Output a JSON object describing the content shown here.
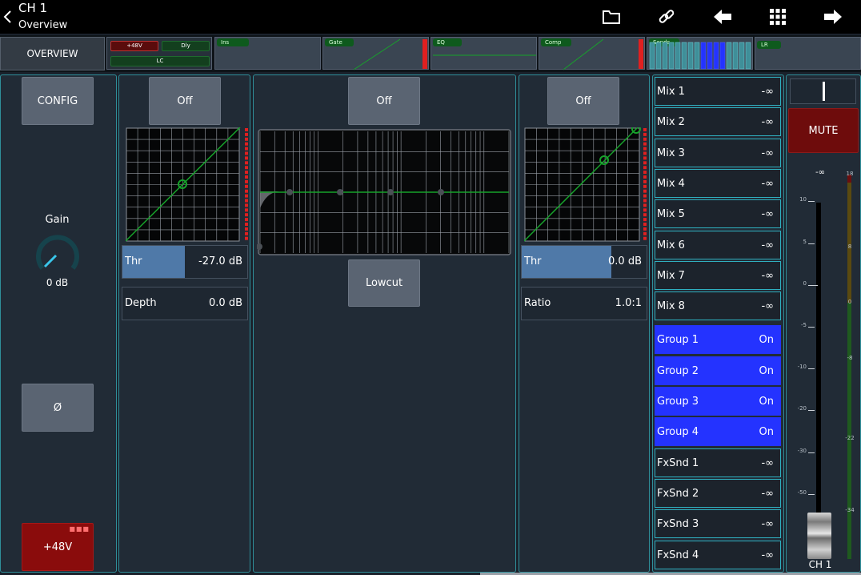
{
  "header": {
    "title": "CH 1",
    "subtitle": "Overview"
  },
  "strip": {
    "overview_tab": "OVERVIEW",
    "tag_48v": "+48V",
    "tag_dly": "Dly",
    "tag_lc": "LC",
    "ins": "Ins",
    "gate": "Gate",
    "eq": "EQ",
    "comp": "Comp",
    "sends": "Sends",
    "lr": "LR"
  },
  "config_panel": {
    "config_label": "CONFIG",
    "gain_label": "Gain",
    "gain_value": "0 dB",
    "phase_label": "Ø",
    "phantom_label": "+48V"
  },
  "gate_panel": {
    "off_label": "Off",
    "thr_label": "Thr",
    "thr_value": "-27.0 dB",
    "thr_level": 0.5,
    "depth_label": "Depth",
    "depth_value": "0.0 dB"
  },
  "eq_panel": {
    "off_label": "Off",
    "lowcut_label": "Lowcut"
  },
  "comp_panel": {
    "off_label": "Off",
    "thr_label": "Thr",
    "thr_value": "0.0 dB",
    "thr_level": 0.72,
    "ratio_label": "Ratio",
    "ratio_value": "1.0:1"
  },
  "sends": [
    {
      "label": "Mix 1",
      "value": "-∞",
      "on": false
    },
    {
      "label": "Mix 2",
      "value": "-∞",
      "on": false
    },
    {
      "label": "Mix 3",
      "value": "-∞",
      "on": false
    },
    {
      "label": "Mix 4",
      "value": "-∞",
      "on": false
    },
    {
      "label": "Mix 5",
      "value": "-∞",
      "on": false
    },
    {
      "label": "Mix 6",
      "value": "-∞",
      "on": false
    },
    {
      "label": "Mix 7",
      "value": "-∞",
      "on": false
    },
    {
      "label": "Mix 8",
      "value": "-∞",
      "on": false
    },
    {
      "label": "Group 1",
      "value": "On",
      "on": true
    },
    {
      "label": "Group 2",
      "value": "On",
      "on": true
    },
    {
      "label": "Group 3",
      "value": "On",
      "on": true
    },
    {
      "label": "Group 4",
      "value": "On",
      "on": true
    },
    {
      "label": "FxSnd 1",
      "value": "-∞",
      "on": false
    },
    {
      "label": "FxSnd 2",
      "value": "-∞",
      "on": false
    },
    {
      "label": "FxSnd 3",
      "value": "-∞",
      "on": false
    },
    {
      "label": "FxSnd 4",
      "value": "-∞",
      "on": false
    }
  ],
  "fader_panel": {
    "mute_label": "MUTE",
    "fader_value": "-∞",
    "channel_label": "CH 1",
    "fader_scale": [
      "10",
      "5",
      "0",
      "-5",
      "-10",
      "-20",
      "-30",
      "-50"
    ],
    "meter_scale": [
      "18",
      "8",
      "0",
      "-8",
      "-22",
      "-34"
    ]
  },
  "colors": {
    "accent_green": "#17a32b",
    "send_on": "#2433ff",
    "mute": "#7a0c0c",
    "panel_border": "#2f8f9a"
  }
}
